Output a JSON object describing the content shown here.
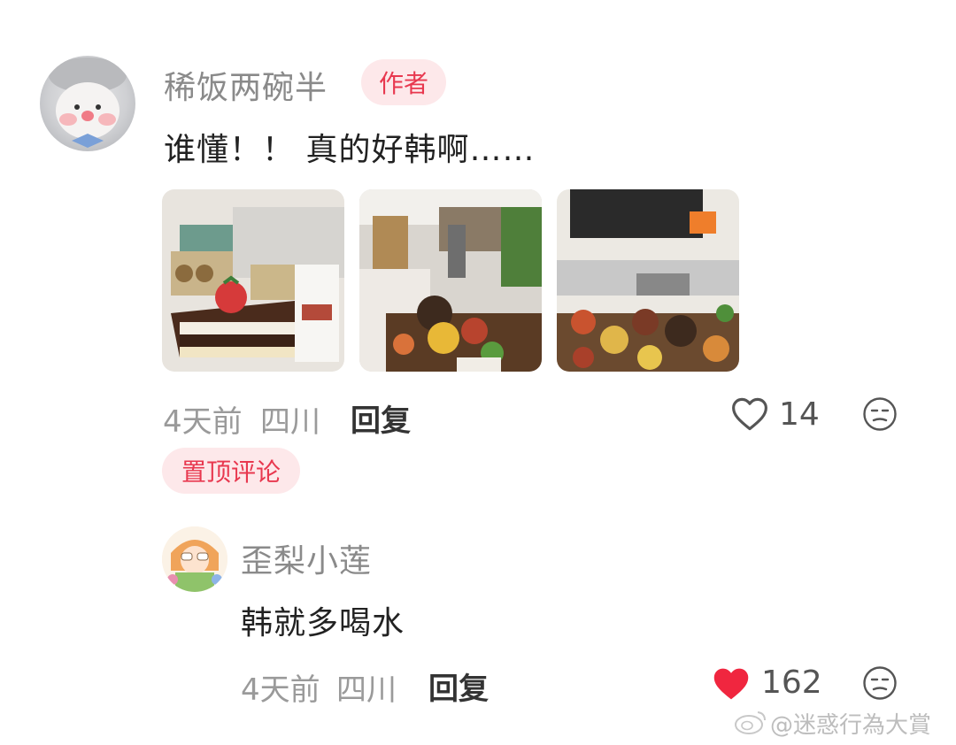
{
  "main_comment": {
    "username": "稀饭两碗半",
    "badge": "作者",
    "text": "谁懂！！ 真的好韩啊……",
    "photos": [
      "photo-cake",
      "photo-restaurant-interior",
      "photo-food-spread"
    ],
    "time": "4天前",
    "location": "四川",
    "reply_label": "回复",
    "likes": "14",
    "pinned_label": "置顶评论"
  },
  "reply_comment": {
    "username": "歪梨小莲",
    "text": "韩就多喝水",
    "time": "4天前",
    "location": "四川",
    "reply_label": "回复",
    "likes": "162",
    "liked": true
  },
  "watermark": "@迷惑行為大賞",
  "colors": {
    "accent_red": "#e8384f",
    "badge_bg": "#fde8ea",
    "muted_text": "#9a9a9a"
  }
}
